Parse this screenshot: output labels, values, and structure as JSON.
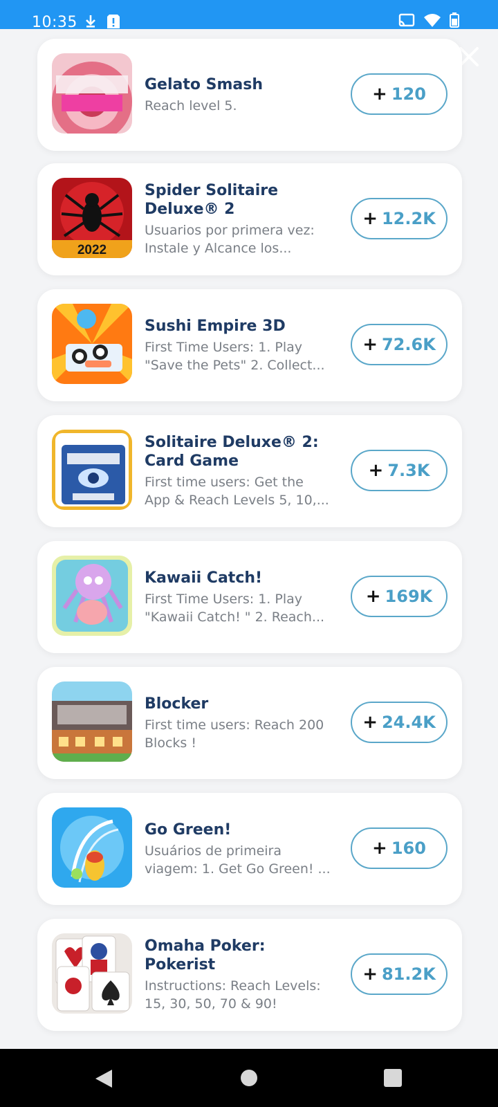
{
  "status_bar": {
    "time": "10:35",
    "icons_left": [
      "download-icon",
      "alert-icon"
    ],
    "icons_right": [
      "cast-icon",
      "wifi-icon",
      "battery-icon"
    ],
    "color": "#2196f3"
  },
  "offers": [
    {
      "title": "Gelato Smash",
      "description": "Reach level 5.",
      "plus": "+",
      "reward": "120",
      "icon": "gelato-smash-icon"
    },
    {
      "title": "Spider Solitaire Deluxe® 2",
      "description": "Usuarios por primera vez: Instale y Alcance los...",
      "plus": "+",
      "reward": "12.2K",
      "icon": "spider-solitaire-icon",
      "icon_badge": "2022"
    },
    {
      "title": "Sushi Empire 3D",
      "description": "First Time Users: 1. Play \"Save the Pets\" 2. Collect...",
      "plus": "+",
      "reward": "72.6K",
      "icon": "sushi-empire-icon"
    },
    {
      "title": "Solitaire Deluxe® 2: Card Game",
      "description": "First time users: Get the App & Reach Levels 5, 10,...",
      "plus": "+",
      "reward": "7.3K",
      "icon": "solitaire-deluxe-icon"
    },
    {
      "title": "Kawaii Catch!",
      "description": "First Time Users: 1. Play \"Kawaii Catch! \" 2. Reach...",
      "plus": "+",
      "reward": "169K",
      "icon": "kawaii-catch-icon"
    },
    {
      "title": "Blocker",
      "description": "First time users: Reach 200 Blocks !",
      "plus": "+",
      "reward": "24.4K",
      "icon": "blocker-icon"
    },
    {
      "title": "Go Green!",
      "description": "Usuários de primeira viagem: 1. Get Go Green! ...",
      "plus": "+",
      "reward": "160",
      "icon": "go-green-icon"
    },
    {
      "title": "Omaha Poker: Pokerist",
      "description": "Instructions: Reach Levels: 15, 30, 50, 70 & 90!",
      "plus": "+",
      "reward": "81.2K",
      "icon": "omaha-poker-icon"
    }
  ],
  "accent_color": "#4a9fc7",
  "title_color": "#1f3b64",
  "nav_bar": {
    "buttons": [
      "back-icon",
      "home-icon",
      "recents-icon"
    ]
  }
}
